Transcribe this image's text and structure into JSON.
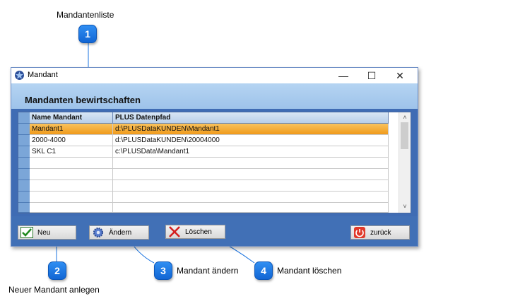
{
  "annotations": {
    "top_label": "Mandantenliste",
    "callouts": [
      {
        "number": "1"
      },
      {
        "number": "2",
        "label": "Neuer Mandant anlegen"
      },
      {
        "number": "3",
        "label": "Mandant ändern"
      },
      {
        "number": "4",
        "label": "Mandant löschen"
      }
    ]
  },
  "window": {
    "title": "Mandant",
    "controls": {
      "minimize": "—",
      "maximize": "☐",
      "close": "✕"
    },
    "header_title": "Mandanten bewirtschaften"
  },
  "table": {
    "columns": [
      "Name Mandant",
      "PLUS Datenpfad"
    ],
    "rows": [
      {
        "name": "Mandant1",
        "path": "d:\\PLUSDataKUNDEN\\Mandant1",
        "selected": true
      },
      {
        "name": "2000-4000",
        "path": "d:\\PLUSDataKUNDEN\\20004000",
        "selected": false
      },
      {
        "name": "SKL C1",
        "path": "c:\\PLUSData\\Mandant1",
        "selected": false
      },
      {
        "name": "",
        "path": "",
        "selected": false
      },
      {
        "name": "",
        "path": "",
        "selected": false
      },
      {
        "name": "",
        "path": "",
        "selected": false
      },
      {
        "name": "",
        "path": "",
        "selected": false
      },
      {
        "name": "",
        "path": "",
        "selected": false
      }
    ],
    "scroll_up": "˄",
    "scroll_down": "˅"
  },
  "buttons": {
    "neu": "Neu",
    "aendern": "Ändern",
    "loeschen": "Löschen",
    "zurueck": "zurück"
  },
  "colors": {
    "callout": "#1a73e0",
    "selection": "#f3a52d",
    "footer": "#4170b6",
    "header_panel": "#a9cbef"
  }
}
